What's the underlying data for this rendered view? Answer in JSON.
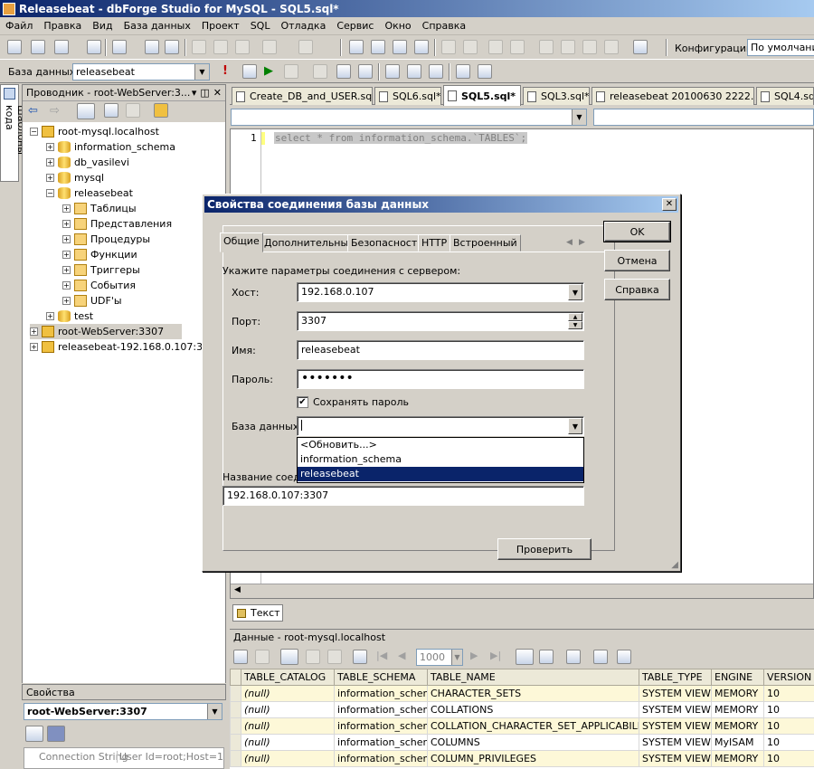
{
  "window": {
    "title": "Releasebeat - dbForge Studio for MySQL - SQL5.sql*"
  },
  "menu": [
    "Файл",
    "Правка",
    "Вид",
    "База данных",
    "Проект",
    "SQL",
    "Отладка",
    "Сервис",
    "Окно",
    "Справка"
  ],
  "toolbar": {
    "config_label": "Конфигурации",
    "config_value": "По умолчанию",
    "db_label": "База данных",
    "db_value": "releasebeat"
  },
  "sidebar_tab": "Шаблоны кода",
  "explorer": {
    "title": "Проводник - root-WebServer:3...",
    "nodes": [
      "root-mysql.localhost",
      "information_schema",
      "db_vasilevi",
      "mysql",
      "releasebeat",
      "Таблицы",
      "Представления",
      "Процедуры",
      "Функции",
      "Триггеры",
      "События",
      "UDF'ы",
      "test",
      "root-WebServer:3307",
      "releasebeat-192.168.0.107:3307"
    ]
  },
  "tabs": [
    "Create_DB_and_USER.sql",
    "SQL6.sql*",
    "SQL5.sql*",
    "SQL3.sql*",
    "releasebeat 20100630 2222.sql",
    "SQL4.sq"
  ],
  "editor": {
    "line_no": "1",
    "code": "select * from information_schema.`TABLES`;"
  },
  "text_tab": "Текст",
  "dialog": {
    "title": "Свойства соединения базы данных",
    "tabs": [
      "Общие",
      "Дополнительные",
      "Безопасность",
      "HTTP",
      "Встроенный"
    ],
    "instruction": "Укажите параметры соединения с сервером:",
    "host_label": "Хост:",
    "host_value": "192.168.0.107",
    "port_label": "Порт:",
    "port_value": "3307",
    "name_label": "Имя:",
    "name_value": "releasebeat",
    "password_label": "Пароль:",
    "password_value": "•••••••",
    "save_password": "Сохранять пароль",
    "database_label": "База данных:",
    "database_value": "",
    "database_options": [
      "<Обновить...>",
      "information_schema",
      "releasebeat"
    ],
    "conn_name_label": "Название соеди",
    "conn_name_value": "192.168.0.107:3307",
    "ok": "OK",
    "cancel": "Отмена",
    "help": "Справка",
    "test": "Проверить"
  },
  "data_panel": {
    "title": "Данные - root-mysql.localhost",
    "page_size": "1000",
    "columns": [
      "TABLE_CATALOG",
      "TABLE_SCHEMA",
      "TABLE_NAME",
      "TABLE_TYPE",
      "ENGINE",
      "VERSION"
    ],
    "rows": [
      [
        "(null)",
        "information_schema",
        "CHARACTER_SETS",
        "SYSTEM VIEW",
        "MEMORY",
        "10"
      ],
      [
        "(null)",
        "information_schema",
        "COLLATIONS",
        "SYSTEM VIEW",
        "MEMORY",
        "10"
      ],
      [
        "(null)",
        "information_schema",
        "COLLATION_CHARACTER_SET_APPLICABILITY",
        "SYSTEM VIEW",
        "MEMORY",
        "10"
      ],
      [
        "(null)",
        "information_schema",
        "COLUMNS",
        "SYSTEM VIEW",
        "MyISAM",
        "10"
      ],
      [
        "(null)",
        "information_schema",
        "COLUMN_PRIVILEGES",
        "SYSTEM VIEW",
        "MEMORY",
        "10"
      ]
    ]
  },
  "properties": {
    "title": "Свойства",
    "object": "root-WebServer:3307",
    "row_label": "Connection String",
    "row_value": "User Id=root;Host=192."
  }
}
